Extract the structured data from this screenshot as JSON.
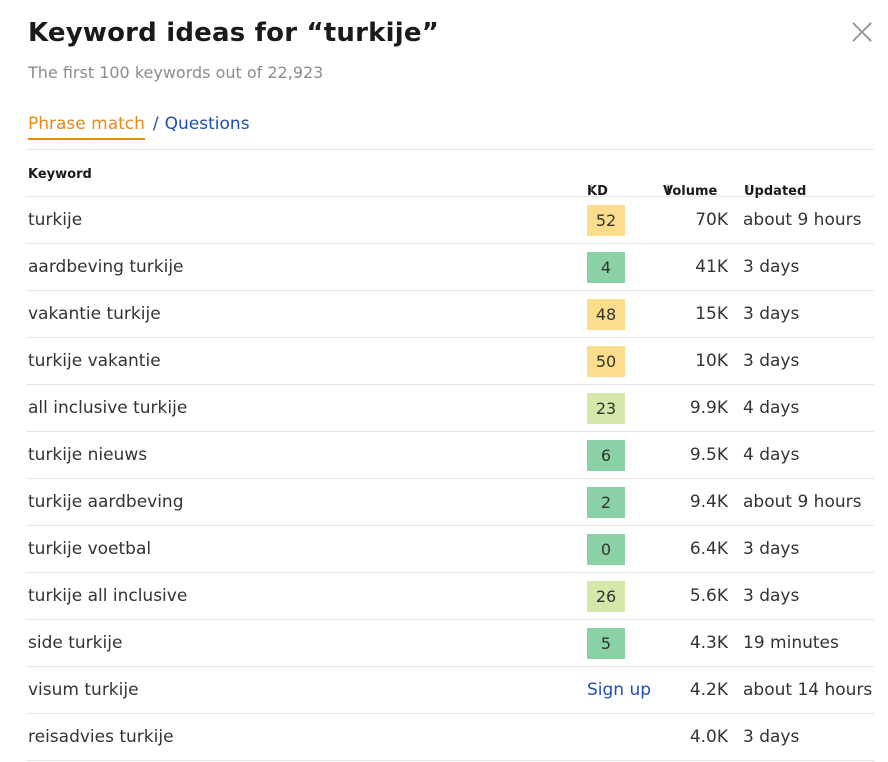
{
  "header": {
    "title": "Keyword ideas for “turkije”",
    "subtitle": "The first 100 keywords out of 22,923",
    "close_icon": "close-icon"
  },
  "tabs": {
    "active": "Phrase match",
    "separator": "/",
    "other": "Questions"
  },
  "colors": {
    "accent_orange": "#e8891c",
    "link_blue": "#1f4fa8",
    "kd_yellow": "#fbdd8b",
    "kd_light_green": "#d5e8a9",
    "kd_green": "#8ad1a6"
  },
  "table": {
    "columns": {
      "keyword": "Keyword",
      "kd": "KD",
      "kd_info": "i",
      "volume": "Volume",
      "volume_sort": "↓",
      "volume_info": "i",
      "updated": "Updated",
      "updated_info": "i"
    },
    "rows": [
      {
        "keyword": "turkije",
        "kd": "52",
        "kd_color": "#fbdd8b",
        "volume": "70K",
        "updated": "about 9 hours"
      },
      {
        "keyword": "aardbeving turkije",
        "kd": "4",
        "kd_color": "#8ad1a6",
        "volume": "41K",
        "updated": "3 days"
      },
      {
        "keyword": "vakantie turkije",
        "kd": "48",
        "kd_color": "#fbdd8b",
        "volume": "15K",
        "updated": "3 days"
      },
      {
        "keyword": "turkije vakantie",
        "kd": "50",
        "kd_color": "#fbdd8b",
        "volume": "10K",
        "updated": "3 days"
      },
      {
        "keyword": "all inclusive turkije",
        "kd": "23",
        "kd_color": "#d5e8a9",
        "volume": "9.9K",
        "updated": "4 days"
      },
      {
        "keyword": "turkije nieuws",
        "kd": "6",
        "kd_color": "#8ad1a6",
        "volume": "9.5K",
        "updated": "4 days"
      },
      {
        "keyword": "turkije aardbeving",
        "kd": "2",
        "kd_color": "#8ad1a6",
        "volume": "9.4K",
        "updated": "about 9 hours"
      },
      {
        "keyword": "turkije voetbal",
        "kd": "0",
        "kd_color": "#8ad1a6",
        "volume": "6.4K",
        "updated": "3 days"
      },
      {
        "keyword": "turkije all inclusive",
        "kd": "26",
        "kd_color": "#d5e8a9",
        "volume": "5.6K",
        "updated": "3 days"
      },
      {
        "keyword": "side turkije",
        "kd": "5",
        "kd_color": "#8ad1a6",
        "volume": "4.3K",
        "updated": "19 minutes"
      },
      {
        "keyword": "visum turkije",
        "kd": "Sign up",
        "kd_signup": true,
        "volume": "4.2K",
        "updated": "about 14 hours"
      },
      {
        "keyword": "reisadvies turkije",
        "kd": "",
        "volume": "4.0K",
        "updated": "3 days"
      }
    ]
  }
}
